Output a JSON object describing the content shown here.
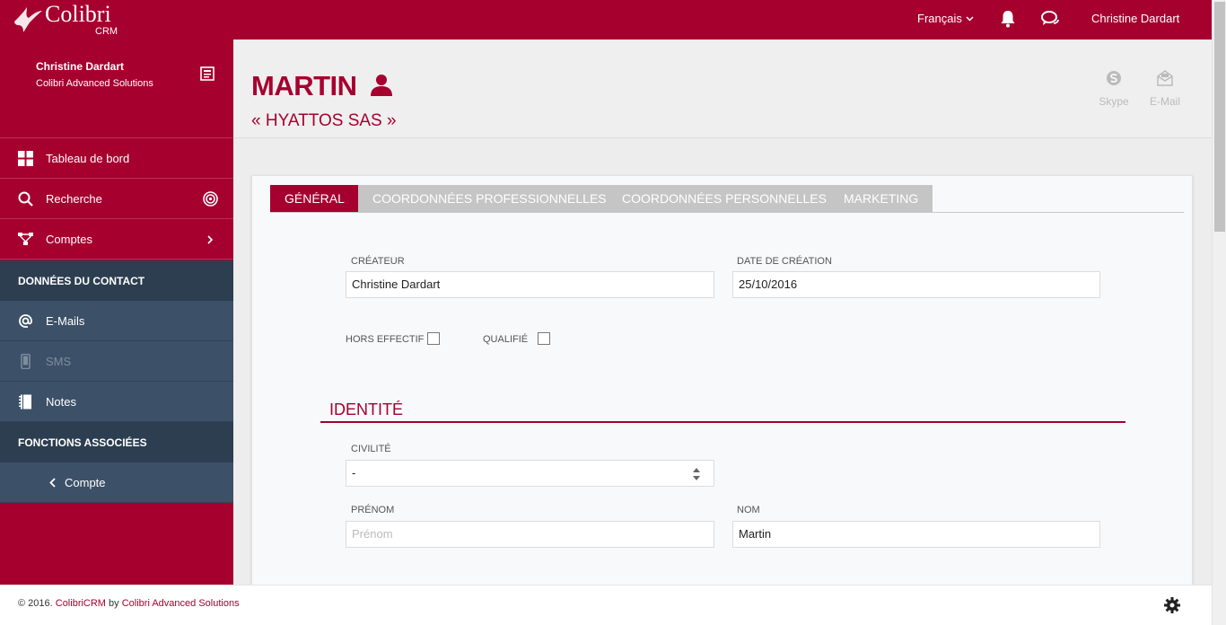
{
  "app": {
    "brand": "Colibri",
    "brand_sub": "CRM"
  },
  "topbar": {
    "language": "Français",
    "user_name": "Christine Dardart"
  },
  "sidebar": {
    "profile_name": "Christine Dardart",
    "profile_company": "Colibri Advanced Solutions",
    "items": [
      {
        "label": "Tableau de bord",
        "icon": "grid-icon"
      },
      {
        "label": "Recherche",
        "icon": "search-icon",
        "right_icon": "target-icon"
      },
      {
        "label": "Comptes",
        "icon": "network-icon",
        "right_icon": "chevron-right-icon"
      }
    ],
    "section_contact": "DONNÉES DU CONTACT",
    "contact_items": [
      {
        "label": "E-Mails",
        "icon": "at-icon"
      },
      {
        "label": "SMS",
        "icon": "mobile-icon"
      },
      {
        "label": "Notes",
        "icon": "notebook-icon"
      }
    ],
    "section_functions": "FONCTIONS ASSOCIÉES",
    "function_items": [
      {
        "label": "Compte",
        "icon": "chevron-left-icon"
      }
    ]
  },
  "header": {
    "title": "MARTIN",
    "subtitle": "« HYATTOS SAS »",
    "actions": [
      {
        "label": "Skype",
        "icon": "skype-icon"
      },
      {
        "label": "E-Mail",
        "icon": "envelope-icon"
      }
    ]
  },
  "tabs": [
    "GÉNÉRAL",
    "COORDONNÉES PROFESSIONNELLES",
    "COORDONNÉES PERSONNELLES",
    "MARKETING"
  ],
  "form": {
    "createur_label": "CRÉATEUR",
    "createur_value": "Christine Dardart",
    "date_label": "DATE DE CRÉATION",
    "date_value": "25/10/2016",
    "hors_effectif_label": "HORS EFFECTIF",
    "hors_effectif_checked": false,
    "qualifie_label": "QUALIFIÉ",
    "qualifie_checked": false,
    "section_identity": "IDENTITÉ",
    "civilite_label": "CIVILITÉ",
    "civilite_value": "-",
    "prenom_label": "PRÉNOM",
    "prenom_placeholder": "Prénom",
    "nom_label": "NOM",
    "nom_value": "Martin"
  },
  "footer": {
    "prefix": "© 2016. ",
    "product": "ColibriCRM",
    "by": " by ",
    "company": "Colibri Advanced Solutions"
  },
  "colors": {
    "brand": "#a6002f",
    "sidebar_dark": "#2c3e50",
    "sidebar_sub": "#3c5168"
  }
}
